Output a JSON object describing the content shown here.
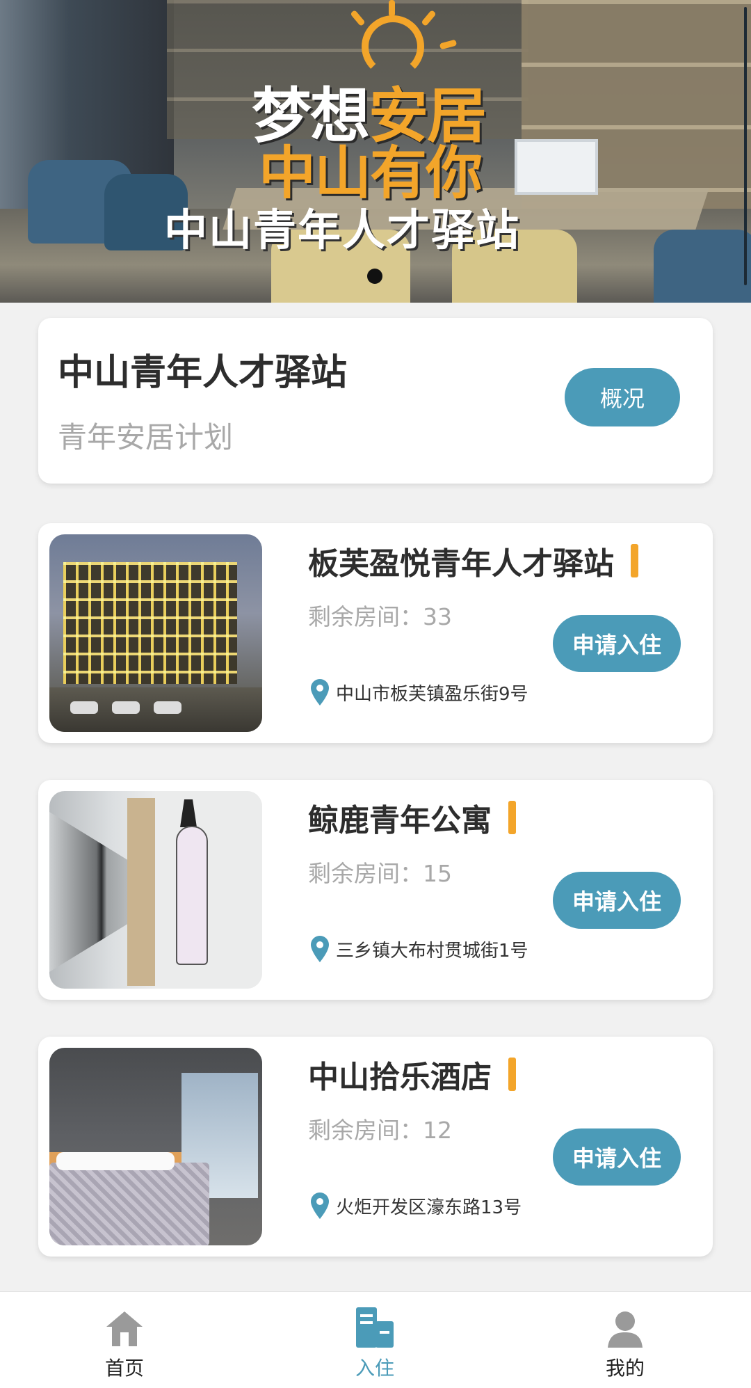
{
  "banner": {
    "slogan_line1_a": "梦想",
    "slogan_line1_b": "安居",
    "slogan_line2": "中山有你",
    "slogan_line3": "中山青年人才驿站",
    "pager_count": 1,
    "pager_active": 1
  },
  "summary": {
    "title": "中山青年人才驿站",
    "subtitle": "青年安居计划",
    "overview_label": "概况"
  },
  "listings": [
    {
      "name": "板芙盈悦青年人才驿站",
      "rooms_label": "剩余房间：",
      "rooms": "33",
      "apply_label": "申请入住",
      "address": "中山市板芙镇盈乐街9号"
    },
    {
      "name": "鲸鹿青年公寓",
      "rooms_label": "剩余房间：",
      "rooms": "15",
      "apply_label": "申请入住",
      "address": "三乡镇大布村贯城街1号"
    },
    {
      "name": "中山拾乐酒店",
      "rooms_label": "剩余房间：",
      "rooms": "12",
      "apply_label": "申请入住",
      "address": "火炬开发区濠东路13号"
    }
  ],
  "tabbar": {
    "items": [
      {
        "label": "首页",
        "icon": "home-icon",
        "active": false
      },
      {
        "label": "入住",
        "icon": "building-icon",
        "active": true
      },
      {
        "label": "我的",
        "icon": "user-icon",
        "active": false
      }
    ]
  },
  "colors": {
    "accent": "#4b9bb8",
    "highlight": "#f3a52a",
    "background": "#f1f1f1"
  }
}
